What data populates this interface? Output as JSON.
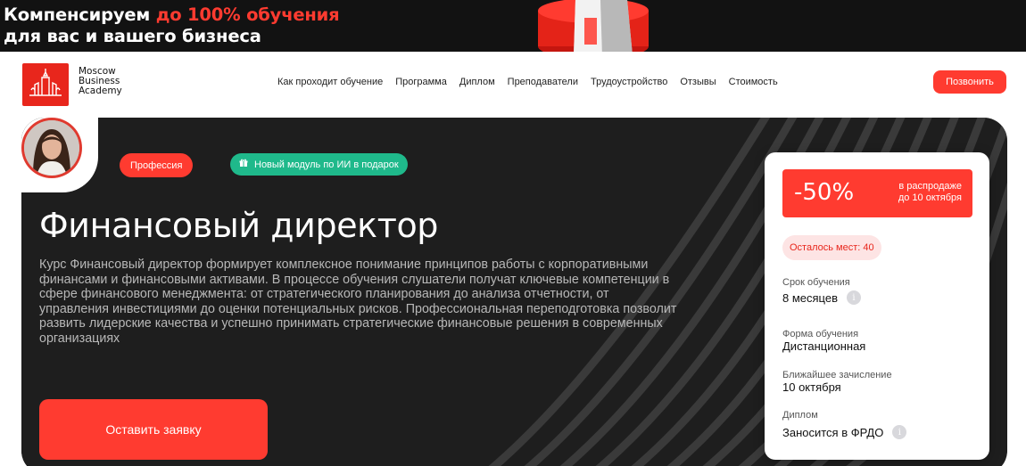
{
  "promo": {
    "line1_prefix": "Компенсируем ",
    "line1_accent": "до 100% обучения",
    "line2": "для вас и вашего бизнеса"
  },
  "header": {
    "logo": [
      "Moscow",
      "Business",
      "Academy"
    ],
    "nav": [
      "Как проходит обучение",
      "Программа",
      "Диплом",
      "Преподаватели",
      "Трудоустройство",
      "Отзывы",
      "Стоимость"
    ],
    "call_label": "Позвонить"
  },
  "hero": {
    "tag_profession": "Профессия",
    "tag_ai": "Новый модуль по ИИ в подарок",
    "title": "Финансовый директор",
    "description": "Курс Финансовый директор формирует комплексное понимание принципов работы с корпоративными финансами и финансовыми активами. В процессе обучения слушатели получат ключевые компетенции в сфере финансового менеджмента: от стратегического планирования до анализа отчетности, от управления инвестициями до оценки потенциальных рисков. Профессиональная переподготовка позволит развить лидерские качества и успешно принимать стратегические финансовые решения в современных организациях",
    "apply_label": "Оставить заявку"
  },
  "card": {
    "discount": "-50%",
    "sale_line1": "в распродаже",
    "sale_line2": "до 10 октября",
    "seats": "Осталось мест: 40",
    "duration_label": "Срок обучения",
    "duration_value": "8 месяцев",
    "format_label": "Форма обучения",
    "format_value": "Дистанционная",
    "enroll_label": "Ближайшее зачисление",
    "enroll_value": "10 октября",
    "diploma_label": "Диплом",
    "diploma_value": "Заносится в ФРДО"
  },
  "colors": {
    "accent": "#ff3b30",
    "green": "#1fb98b",
    "dark": "#1e1e1e"
  }
}
